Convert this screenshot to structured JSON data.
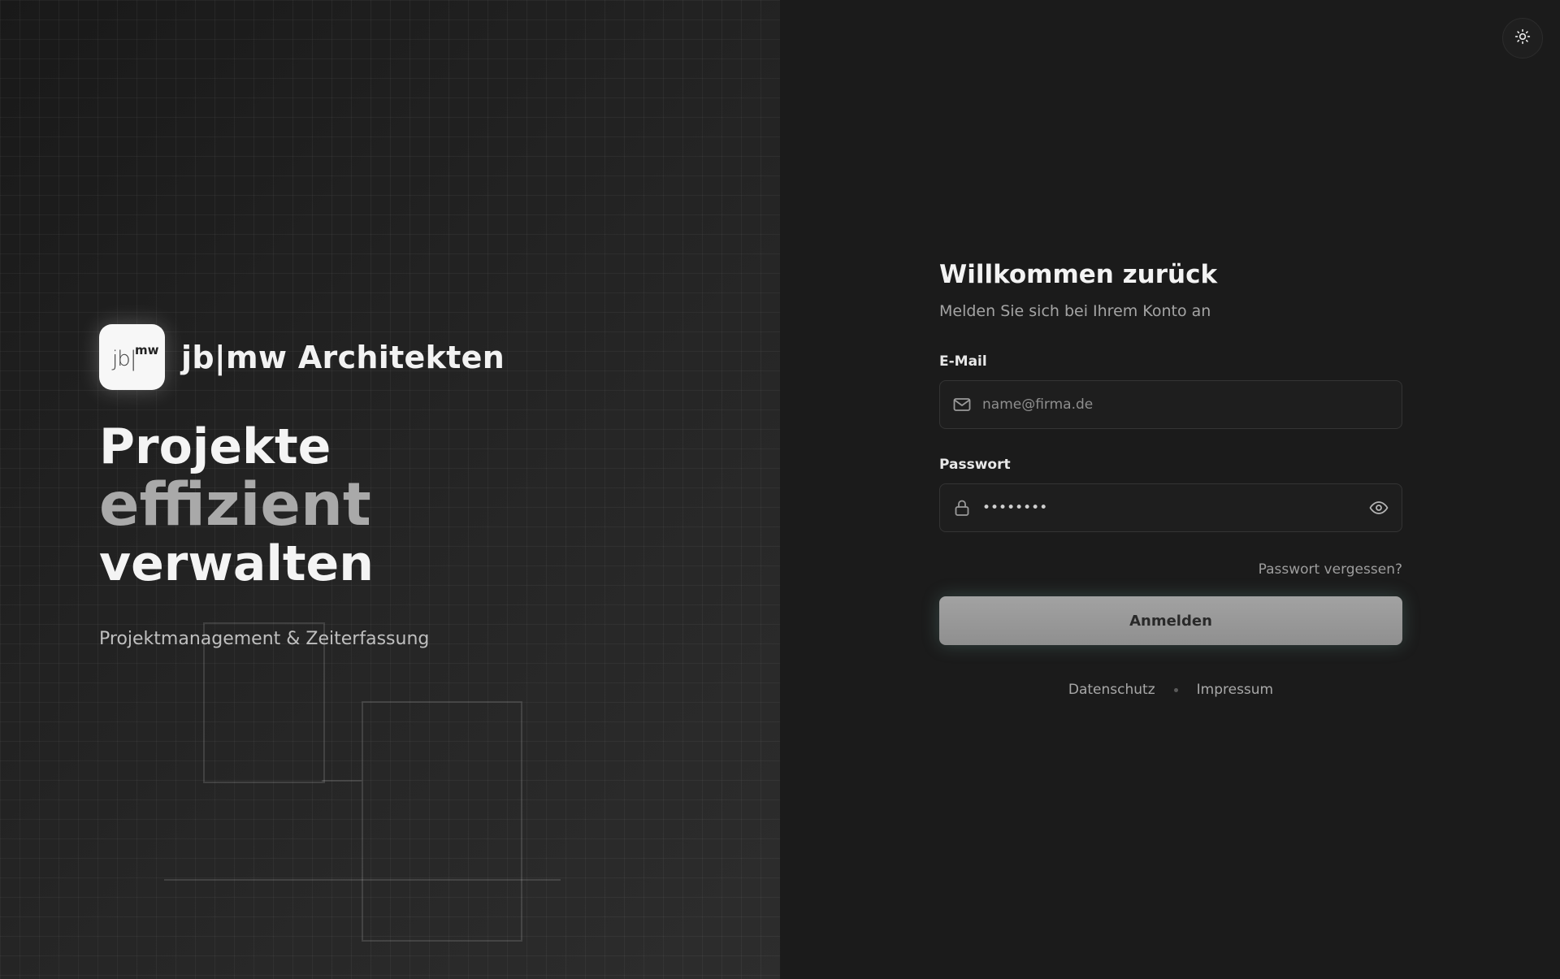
{
  "brand": {
    "logo_jb": "jb|",
    "logo_mw": "mw",
    "name": "jb|mw Architekten"
  },
  "hero": {
    "line1": "Projekte",
    "line2": "effizient",
    "line3": "verwalten",
    "tagline": "Projektmanagement & Zeiterfassung"
  },
  "theme_toggle": {
    "icon": "sun-icon"
  },
  "login": {
    "title": "Willkommen zurück",
    "subtitle": "Melden Sie sich bei Ihrem Konto an",
    "email_label": "E-Mail",
    "email_placeholder": "name@firma.de",
    "email_icon": "mail-icon",
    "password_label": "Passwort",
    "password_value": "••••••••",
    "password_icon": "lock-icon",
    "show_password_icon": "eye-icon",
    "forgot_password": "Passwort vergessen?",
    "submit_label": "Anmelden"
  },
  "footer": {
    "privacy": "Datenschutz",
    "imprint": "Impressum"
  },
  "colors": {
    "background_left": "#222222",
    "background_right": "#1b1b1b",
    "text_primary": "#f3f3f3",
    "text_muted": "#a4a4a4",
    "button_bg": "#9a9a9a",
    "button_glow": "#78b4aa"
  }
}
